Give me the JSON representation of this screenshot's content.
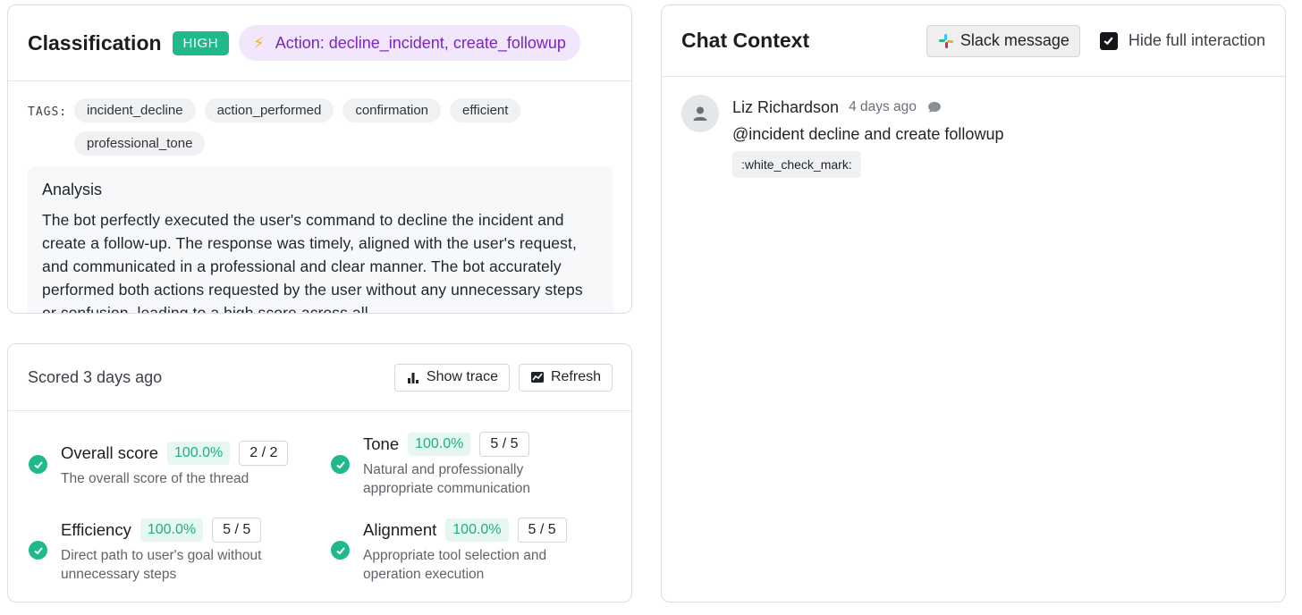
{
  "classification": {
    "title": "Classification",
    "level": "HIGH",
    "action": "Action: decline_incident, create_followup",
    "tags_label": "TAGS:",
    "tags": [
      "incident_decline",
      "action_performed",
      "confirmation",
      "efficient",
      "professional_tone"
    ],
    "analysis_title": "Analysis",
    "analysis_text": "The bot perfectly executed the user's command to decline the incident and create a follow-up. The response was timely, aligned with the user's request, and communicated in a professional and clear manner. The bot accurately performed both actions requested by the user without any unnecessary steps or confusion, leading to a high score across all"
  },
  "scoring": {
    "scored_text": "Scored 3 days ago",
    "show_trace_label": "Show trace",
    "refresh_label": "Refresh",
    "metrics": [
      {
        "name": "Overall score",
        "percent": "100.0%",
        "fraction": "2 / 2",
        "description": "The overall score of the thread"
      },
      {
        "name": "Tone",
        "percent": "100.0%",
        "fraction": "5 / 5",
        "description": "Natural and professionally appropriate communication"
      },
      {
        "name": "Efficiency",
        "percent": "100.0%",
        "fraction": "5 / 5",
        "description": "Direct path to user's goal without unnecessary steps"
      },
      {
        "name": "Alignment",
        "percent": "100.0%",
        "fraction": "5 / 5",
        "description": "Appropriate tool selection and operation execution"
      }
    ]
  },
  "chat": {
    "title": "Chat Context",
    "slack_button_label": "Slack message",
    "hide_toggle_label": "Hide full interaction",
    "hide_toggle_checked": true,
    "message": {
      "author": "Liz Richardson",
      "time": "4 days ago",
      "text": "@incident decline and create followup",
      "reaction": ":white_check_mark:"
    }
  },
  "colors": {
    "accent_green": "#1fb98c",
    "action_purple": "#7a25c4",
    "action_bg": "#f1e6fb"
  },
  "icons": {
    "action": "lightning-bolt-icon",
    "trace": "bar-chart-icon",
    "refresh": "trend-chart-icon",
    "slack": "slack-logo-icon",
    "check": "check-circle-icon",
    "avatar": "user-icon",
    "comment": "speech-bubble-icon"
  }
}
